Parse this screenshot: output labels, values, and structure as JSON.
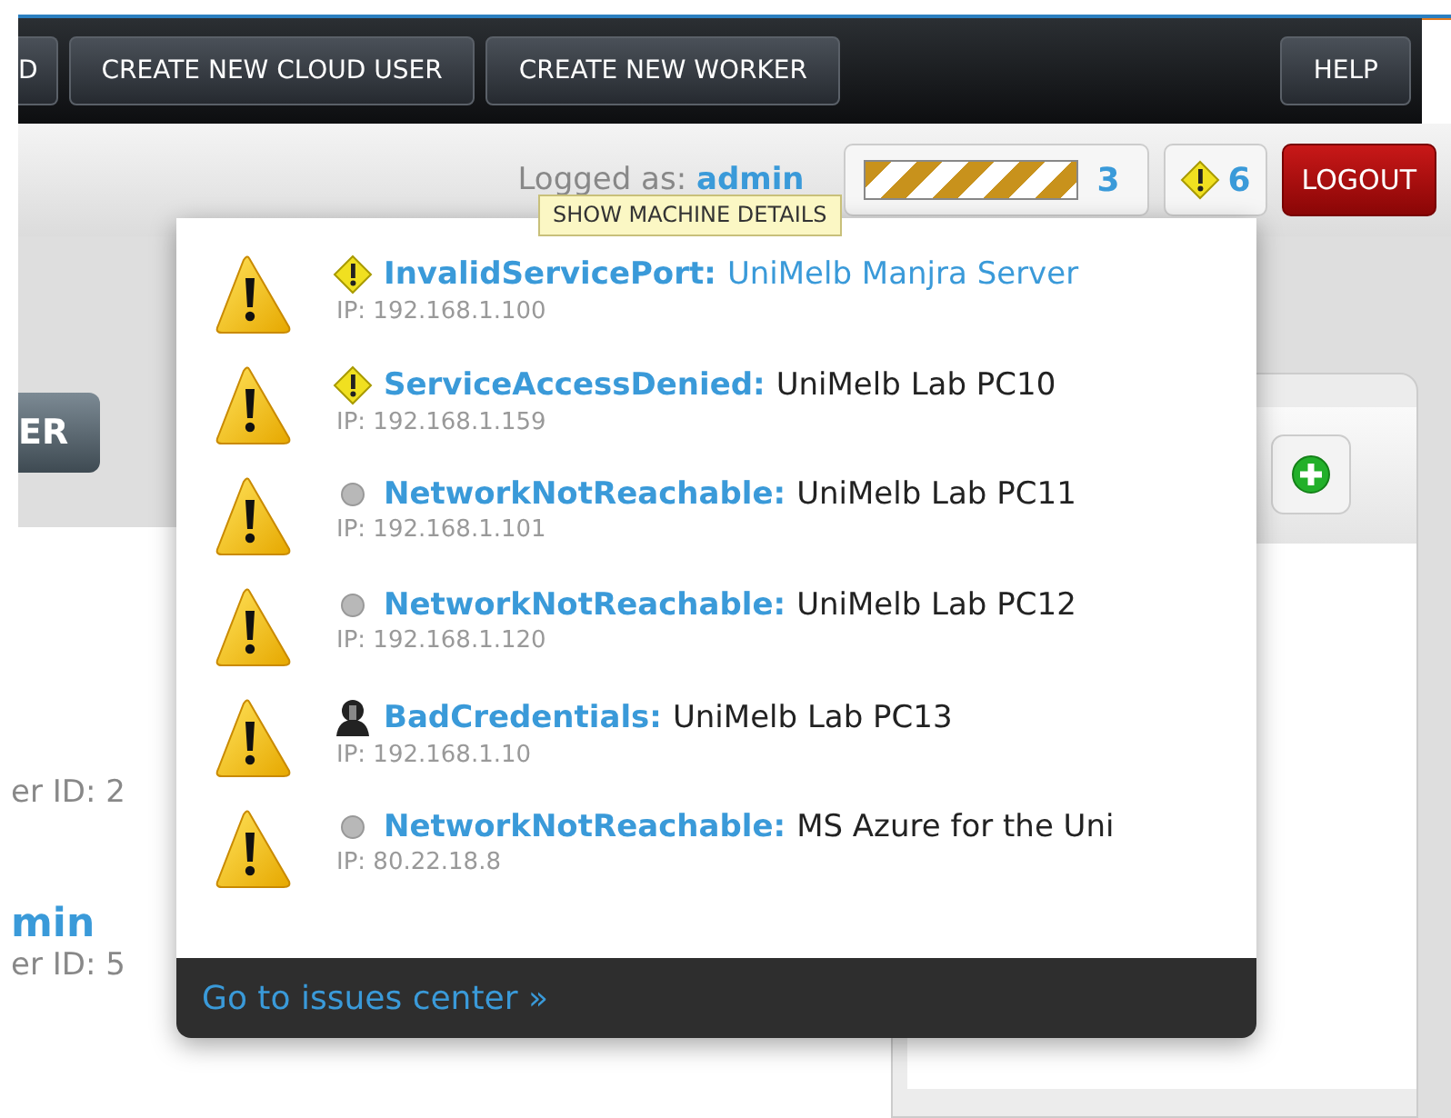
{
  "nav_buttons": [
    "D",
    "CREATE NEW CLOUD USER",
    "CREATE NEW WORKER"
  ],
  "help": "HELP",
  "user_bar": {
    "logged_label": "Logged as:",
    "user": "admin",
    "progress_count": "3",
    "issues_count": "6",
    "logout": "LOGOUT"
  },
  "tooltip": "SHOW MACHINE DETAILS",
  "issues": [
    {
      "kind": "warning",
      "type": "InvalidServicePort:",
      "machine": "UniMelb Manjra Server",
      "ip": "IP: 192.168.1.100",
      "hovered": true
    },
    {
      "kind": "warning",
      "type": "ServiceAccessDenied:",
      "machine": "UniMelb Lab PC10",
      "ip": "IP: 192.168.1.159",
      "hovered": false
    },
    {
      "kind": "offline",
      "type": "NetworkNotReachable:",
      "machine": "UniMelb Lab PC11",
      "ip": "IP: 192.168.1.101",
      "hovered": false
    },
    {
      "kind": "offline",
      "type": "NetworkNotReachable:",
      "machine": "UniMelb Lab PC12",
      "ip": "IP: 192.168.1.120",
      "hovered": false
    },
    {
      "kind": "credentials",
      "type": "BadCredentials:",
      "machine": "UniMelb Lab PC13",
      "ip": "IP: 192.168.1.10",
      "hovered": false
    },
    {
      "kind": "offline",
      "type": "NetworkNotReachable:",
      "machine": "MS Azure for the Uni",
      "ip": "IP: 80.22.18.8",
      "hovered": false
    }
  ],
  "issues_link": "Go to issues center »",
  "background": {
    "button": "ER",
    "users": [
      {
        "id_text": "er ID: 2"
      },
      {
        "name": "min",
        "id_text": "er ID: 5"
      }
    ]
  }
}
